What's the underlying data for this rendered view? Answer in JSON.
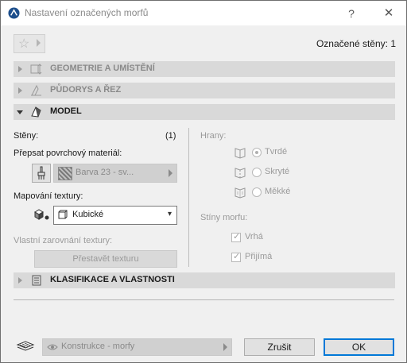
{
  "window": {
    "title": "Nastavení označených morfů",
    "help_glyph": "?",
    "close_glyph": "✕"
  },
  "header": {
    "selected_count": "Označené stěny: 1"
  },
  "sections": {
    "geometry": "GEOMETRIE A UMÍSTĚNÍ",
    "floorplan": "PŮDORYS A ŘEZ",
    "model": "MODEL",
    "classification": "KLASIFIKACE A VLASTNOSTI"
  },
  "model": {
    "faces_label": "Stěny:",
    "faces_count": "(1)",
    "override_label": "Přepsat povrchový materiál:",
    "material_value": "Barva 23 - sv...",
    "texture_mapping_label": "Mapování textury:",
    "texture_mapping_value": "Kubické",
    "custom_alignment_label": "Vlastní zarovnání textury:",
    "rebuild_button": "Přestavět texturu",
    "edges_label": "Hrany:",
    "edge_options": [
      "Tvrdé",
      "Skryté",
      "Měkké"
    ],
    "edge_selected": "Tvrdé",
    "shadows_label": "Stíny morfu:",
    "shadow_options": [
      {
        "label": "Vrhá",
        "checked": true
      },
      {
        "label": "Přijímá",
        "checked": true
      }
    ]
  },
  "footer": {
    "layer_value": "Konstrukce - morfy",
    "cancel_button": "Zrušit",
    "ok_button": "OK"
  },
  "icons": {
    "app": "archicad-logo-icon",
    "favorites": "star-icon",
    "geometry": "geometry-icon",
    "floorplan": "floorplan-icon",
    "model": "model-icon",
    "classification": "list-icon",
    "brush": "brush-icon",
    "texture": "texture-mapping-icon",
    "edges": [
      "hard-edge-icon",
      "hidden-edge-icon",
      "soft-edge-icon"
    ],
    "layer": "layer-icon",
    "eye": "eye-icon"
  },
  "colors": {
    "accent": "#0078d7",
    "section_bar": "#d9d9d9",
    "dialog_bg": "#f0f0f0"
  }
}
